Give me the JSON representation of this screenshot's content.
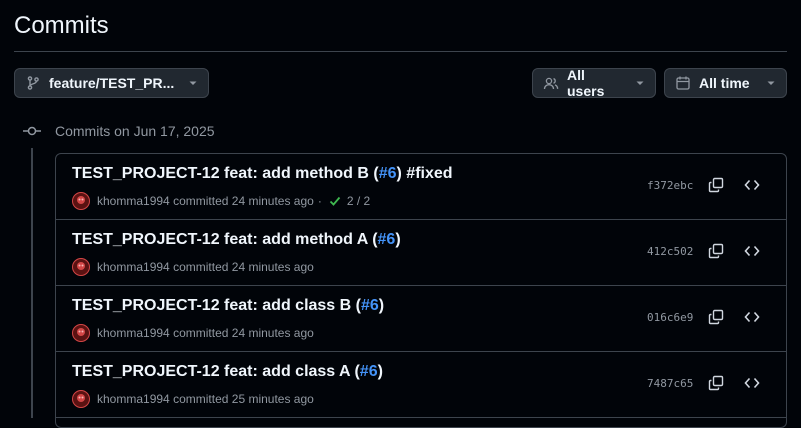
{
  "page": {
    "title": "Commits"
  },
  "filters": {
    "branch": {
      "label": "feature/TEST_PR...",
      "icon": "git-branch-icon"
    },
    "users": {
      "label": "All users",
      "icon": "people-icon"
    },
    "time": {
      "label": "All time",
      "icon": "calendar-icon"
    }
  },
  "group": {
    "heading": "Commits on Jun 17, 2025"
  },
  "commits": [
    {
      "title": "TEST_PROJECT-12 feat: add method B (",
      "pr": "#6",
      "suffix": ") #fixed",
      "author": "khomma1994",
      "action": "committed",
      "time": "24 minutes ago",
      "checks": "2 / 2",
      "sha": "f372ebc"
    },
    {
      "title": "TEST_PROJECT-12 feat: add method A (",
      "pr": "#6",
      "suffix": ")",
      "author": "khomma1994",
      "action": "committed",
      "time": "24 minutes ago",
      "sha": "412c502"
    },
    {
      "title": "TEST_PROJECT-12 feat: add class B (",
      "pr": "#6",
      "suffix": ")",
      "author": "khomma1994",
      "action": "committed",
      "time": "24 minutes ago",
      "sha": "016c6e9"
    },
    {
      "title": "TEST_PROJECT-12 feat: add class A (",
      "pr": "#6",
      "suffix": ")",
      "author": "khomma1994",
      "action": "committed",
      "time": "25 minutes ago",
      "sha": "7487c65"
    }
  ],
  "colors": {
    "background": "#010409",
    "border": "#3d444d",
    "link": "#4493f8",
    "success": "#3fb950",
    "muted": "#9198a1"
  }
}
